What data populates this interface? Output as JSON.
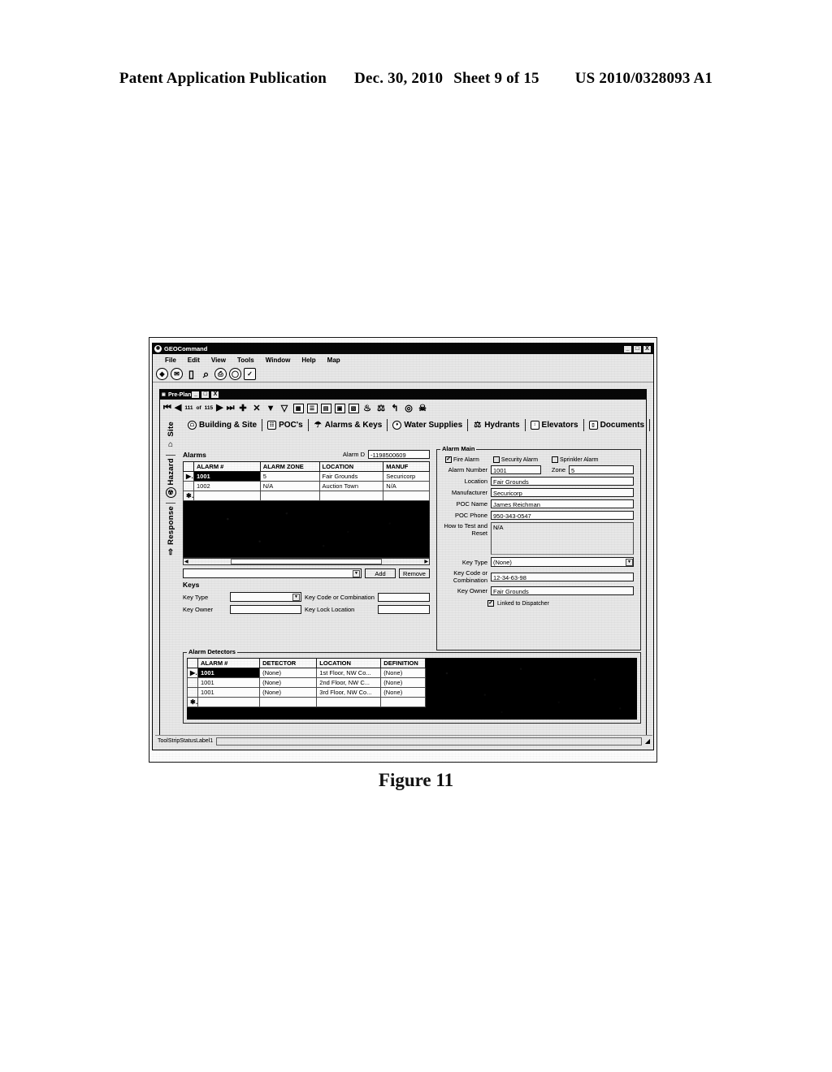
{
  "patent_header": {
    "publication": "Patent Application Publication",
    "date": "Dec. 30, 2010",
    "sheet": "Sheet 9 of 15",
    "number": "US 2010/0328093 A1"
  },
  "figure": {
    "caption": "Figure 11"
  },
  "app_window": {
    "title": "GEOCommand",
    "title_icon": "globe-icon",
    "window_buttons": {
      "minimize": "_",
      "maximize": "□",
      "close": "X"
    },
    "menus": [
      "File",
      "Edit",
      "View",
      "Tools",
      "Window",
      "Help",
      "Map"
    ],
    "toolbar_icons": [
      "globe-icon",
      "address-book-icon",
      "document-icon",
      "search-icon",
      "printer-icon",
      "clock-icon",
      "checklist-icon"
    ]
  },
  "mdi_window": {
    "title": "Pre-Plan",
    "title_icon": "preplan-icon",
    "window_buttons": {
      "minimize": "_",
      "maximize": "□",
      "close": "X"
    },
    "nav": {
      "first": "⏮",
      "previous": "◀",
      "current_record": "111",
      "of_label": "of",
      "total_records": "115",
      "next": "▶",
      "last": "⏭",
      "add": "✚",
      "delete": "✕"
    },
    "nav_tools": [
      "filter-icon",
      "filter-advanced-icon",
      "grid-icon",
      "list-icon",
      "report-icon",
      "export-icon",
      "notes-icon",
      "fire-icon",
      "hydrant-map-icon",
      "undo-icon",
      "target-icon",
      "hazard-icon"
    ]
  },
  "tabs": [
    {
      "label": "Building & Site",
      "icon": "building-icon",
      "active": false
    },
    {
      "label": "POC's",
      "icon": "contacts-icon",
      "active": false
    },
    {
      "label": "Alarms & Keys",
      "icon": "alarm-bell-icon",
      "active": true
    },
    {
      "label": "Water Supplies",
      "icon": "water-drop-icon",
      "active": false
    },
    {
      "label": "Hydrants",
      "icon": "hydrant-icon",
      "active": false
    },
    {
      "label": "Elevators",
      "icon": "elevator-icon",
      "active": false
    },
    {
      "label": "Documents",
      "icon": "document-icon",
      "active": false
    }
  ],
  "sidebar": {
    "items": [
      {
        "label": "Site",
        "icon": "house-icon"
      },
      {
        "label": "Hazard",
        "icon": "radiation-icon"
      },
      {
        "label": "Response",
        "icon": "up-arrow-icon"
      }
    ]
  },
  "alarms_section": {
    "group_label": "Alarms",
    "alarm_id_label": "Alarm D",
    "alarm_id_value": "-1198500609",
    "columns": [
      "ALARM #",
      "ALARM ZONE",
      "LOCATION",
      "MANUF"
    ],
    "rows": [
      {
        "marker": "▶",
        "alarm": "1001",
        "zone": "5",
        "location": "Fair Grounds",
        "manuf": "Securicorp",
        "selected": true
      },
      {
        "marker": "",
        "alarm": "1002",
        "zone": "N/A",
        "location": "Auction Town",
        "manuf": "N/A",
        "selected": false
      },
      {
        "marker": "✱",
        "alarm": "",
        "zone": "",
        "location": "",
        "manuf": "",
        "selected": false
      }
    ],
    "add_combo_value": "",
    "add_button": "Add",
    "remove_button": "Remove"
  },
  "keys_section": {
    "group_label": "Keys",
    "key_type_label": "Key Type",
    "key_type_value": "",
    "key_code_label": "Key Code or Combination",
    "key_code_value": "",
    "key_owner_label": "Key Owner",
    "key_owner_value": "",
    "key_lock_label": "Key Lock Location",
    "key_lock_value": ""
  },
  "alarm_main": {
    "legend": "Alarm Main",
    "checkboxes": [
      {
        "label": "Fire Alarm",
        "checked": true
      },
      {
        "label": "Security Alarm",
        "checked": false
      },
      {
        "label": "Sprinkler Alarm",
        "checked": false
      }
    ],
    "alarm_number_label": "Alarm Number",
    "alarm_number_value": "1001",
    "zone_label": "Zone",
    "zone_value": "5",
    "location_label": "Location",
    "location_value": "Fair Grounds",
    "manufacturer_label": "Manufacturer",
    "manufacturer_value": "Securicorp",
    "poc_name_label": "POC Name",
    "poc_name_value": "James Reichman",
    "poc_phone_label": "POC Phone",
    "poc_phone_value": "950-343-0547",
    "how_to_test_label": "How to Test and Reset",
    "how_to_test_value": "N/A",
    "key_type_label": "Key Type",
    "key_type_value": "(None)",
    "key_code_label": "Key Code or Combination",
    "key_code_value": "12-34-63-98",
    "key_owner_label": "Key Owner",
    "key_owner_value": "Fair Grounds",
    "linked_label": "Linked to Dispatcher",
    "linked_checked": true
  },
  "detectors_section": {
    "legend": "Alarm Detectors",
    "columns": [
      "ALARM #",
      "DETECTOR",
      "LOCATION",
      "DEFINITION"
    ],
    "rows": [
      {
        "marker": "▶",
        "alarm": "1001",
        "detector": "(None)",
        "location": "1st Floor, NW Co...",
        "definition": "(None)",
        "selected": true
      },
      {
        "marker": "",
        "alarm": "1001",
        "detector": "(None)",
        "location": "2nd Floor, NW C...",
        "definition": "(None)",
        "selected": false
      },
      {
        "marker": "",
        "alarm": "1001",
        "detector": "(None)",
        "location": "3rd Floor, NW Co...",
        "definition": "(None)",
        "selected": false
      },
      {
        "marker": "✱",
        "alarm": "",
        "detector": "",
        "location": "",
        "definition": "",
        "selected": false
      }
    ]
  },
  "status_bar": {
    "label": "ToolStripStatusLabel1",
    "field_value": ""
  }
}
